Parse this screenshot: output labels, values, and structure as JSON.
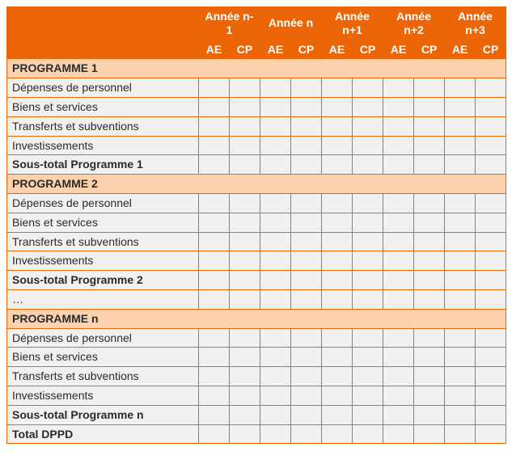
{
  "years": [
    {
      "label": "Année n-1",
      "sub": [
        "AE",
        "CP"
      ]
    },
    {
      "label": "Année n",
      "sub": [
        "AE",
        "CP"
      ]
    },
    {
      "label": "Année n+1",
      "sub": [
        "AE",
        "CP"
      ]
    },
    {
      "label": "Année n+2",
      "sub": [
        "AE",
        "CP"
      ]
    },
    {
      "label": "Année n+3",
      "sub": [
        "AE",
        "CP"
      ]
    }
  ],
  "sections": [
    {
      "header": "PROGRAMME 1",
      "rows": [
        {
          "label": "Dépenses de personnel",
          "values": [
            "",
            "",
            "",
            "",
            "",
            "",
            "",
            "",
            "",
            ""
          ]
        },
        {
          "label": "Biens et services",
          "values": [
            "",
            "",
            "",
            "",
            "",
            "",
            "",
            "",
            "",
            ""
          ]
        },
        {
          "label": "Transferts et subventions",
          "values": [
            "",
            "",
            "",
            "",
            "",
            "",
            "",
            "",
            "",
            ""
          ]
        },
        {
          "label": "Investissements",
          "values": [
            "",
            "",
            "",
            "",
            "",
            "",
            "",
            "",
            "",
            ""
          ]
        }
      ],
      "subtotal": {
        "label": "Sous-total Programme 1",
        "values": [
          "",
          "",
          "",
          "",
          "",
          "",
          "",
          "",
          "",
          ""
        ]
      }
    },
    {
      "header": "PROGRAMME 2",
      "rows": [
        {
          "label": "Dépenses de personnel",
          "values": [
            "",
            "",
            "",
            "",
            "",
            "",
            "",
            "",
            "",
            ""
          ]
        },
        {
          "label": "Biens et services",
          "values": [
            "",
            "",
            "",
            "",
            "",
            "",
            "",
            "",
            "",
            ""
          ]
        },
        {
          "label": "Transferts et subventions",
          "values": [
            "",
            "",
            "",
            "",
            "",
            "",
            "",
            "",
            "",
            ""
          ]
        },
        {
          "label": "Investissements",
          "values": [
            "",
            "",
            "",
            "",
            "",
            "",
            "",
            "",
            "",
            ""
          ]
        }
      ],
      "subtotal": {
        "label": "Sous-total Programme 2",
        "values": [
          "",
          "",
          "",
          "",
          "",
          "",
          "",
          "",
          "",
          ""
        ]
      }
    },
    {
      "ellipsis": {
        "label": "…",
        "values": [
          "",
          "",
          "",
          "",
          "",
          "",
          "",
          "",
          "",
          ""
        ]
      }
    },
    {
      "header": "PROGRAMME n",
      "rows": [
        {
          "label": "Dépenses de personnel",
          "values": [
            "",
            "",
            "",
            "",
            "",
            "",
            "",
            "",
            "",
            ""
          ]
        },
        {
          "label": "Biens et services",
          "values": [
            "",
            "",
            "",
            "",
            "",
            "",
            "",
            "",
            "",
            ""
          ]
        },
        {
          "label": "Transferts et subventions",
          "values": [
            "",
            "",
            "",
            "",
            "",
            "",
            "",
            "",
            "",
            ""
          ]
        },
        {
          "label": "Investissements",
          "values": [
            "",
            "",
            "",
            "",
            "",
            "",
            "",
            "",
            "",
            ""
          ]
        }
      ],
      "subtotal": {
        "label": "Sous-total Programme n",
        "values": [
          "",
          "",
          "",
          "",
          "",
          "",
          "",
          "",
          "",
          ""
        ]
      }
    }
  ],
  "grand_total": {
    "label": "Total DPPD",
    "values": [
      "",
      "",
      "",
      "",
      "",
      "",
      "",
      "",
      "",
      ""
    ]
  }
}
